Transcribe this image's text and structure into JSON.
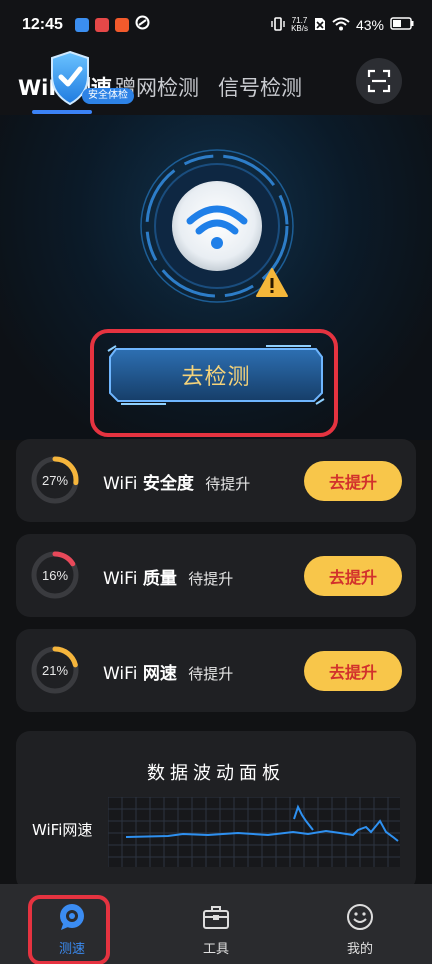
{
  "status_bar": {
    "time": "12:45",
    "net_speed_value": "71.7",
    "net_speed_unit": "KB/s",
    "battery": "43%"
  },
  "tabs": [
    {
      "label": "WiFi测速"
    },
    {
      "label": "蹭网检测"
    },
    {
      "label": "信号检测"
    }
  ],
  "badge": {
    "label": "安全体检"
  },
  "hero": {
    "detect_label": "去检测"
  },
  "metrics": [
    {
      "percent": 27,
      "percent_text": "27%",
      "prefix": "WiFi",
      "name": "安全度",
      "status": "待提升",
      "button": "去提升",
      "ring_color": "#f5b53c"
    },
    {
      "percent": 16,
      "percent_text": "16%",
      "prefix": "WiFi",
      "name": "质量",
      "status": "待提升",
      "button": "去提升",
      "ring_color": "#e8495a"
    },
    {
      "percent": 21,
      "percent_text": "21%",
      "prefix": "WiFi",
      "name": "网速",
      "status": "待提升",
      "button": "去提升",
      "ring_color": "#f5b53c"
    }
  ],
  "panel": {
    "title": "数据波动面板",
    "speed_label": "WiFi网速",
    "line_color": "#2e90f0"
  },
  "nav": [
    {
      "label": "测速",
      "active": true
    },
    {
      "label": "工具",
      "active": false
    },
    {
      "label": "我的",
      "active": false
    }
  ],
  "colors": {
    "accent": "#3b82f6",
    "button_yellow": "#f8c64a",
    "button_text_red": "#d2312c",
    "highlight_red": "#e53340"
  }
}
